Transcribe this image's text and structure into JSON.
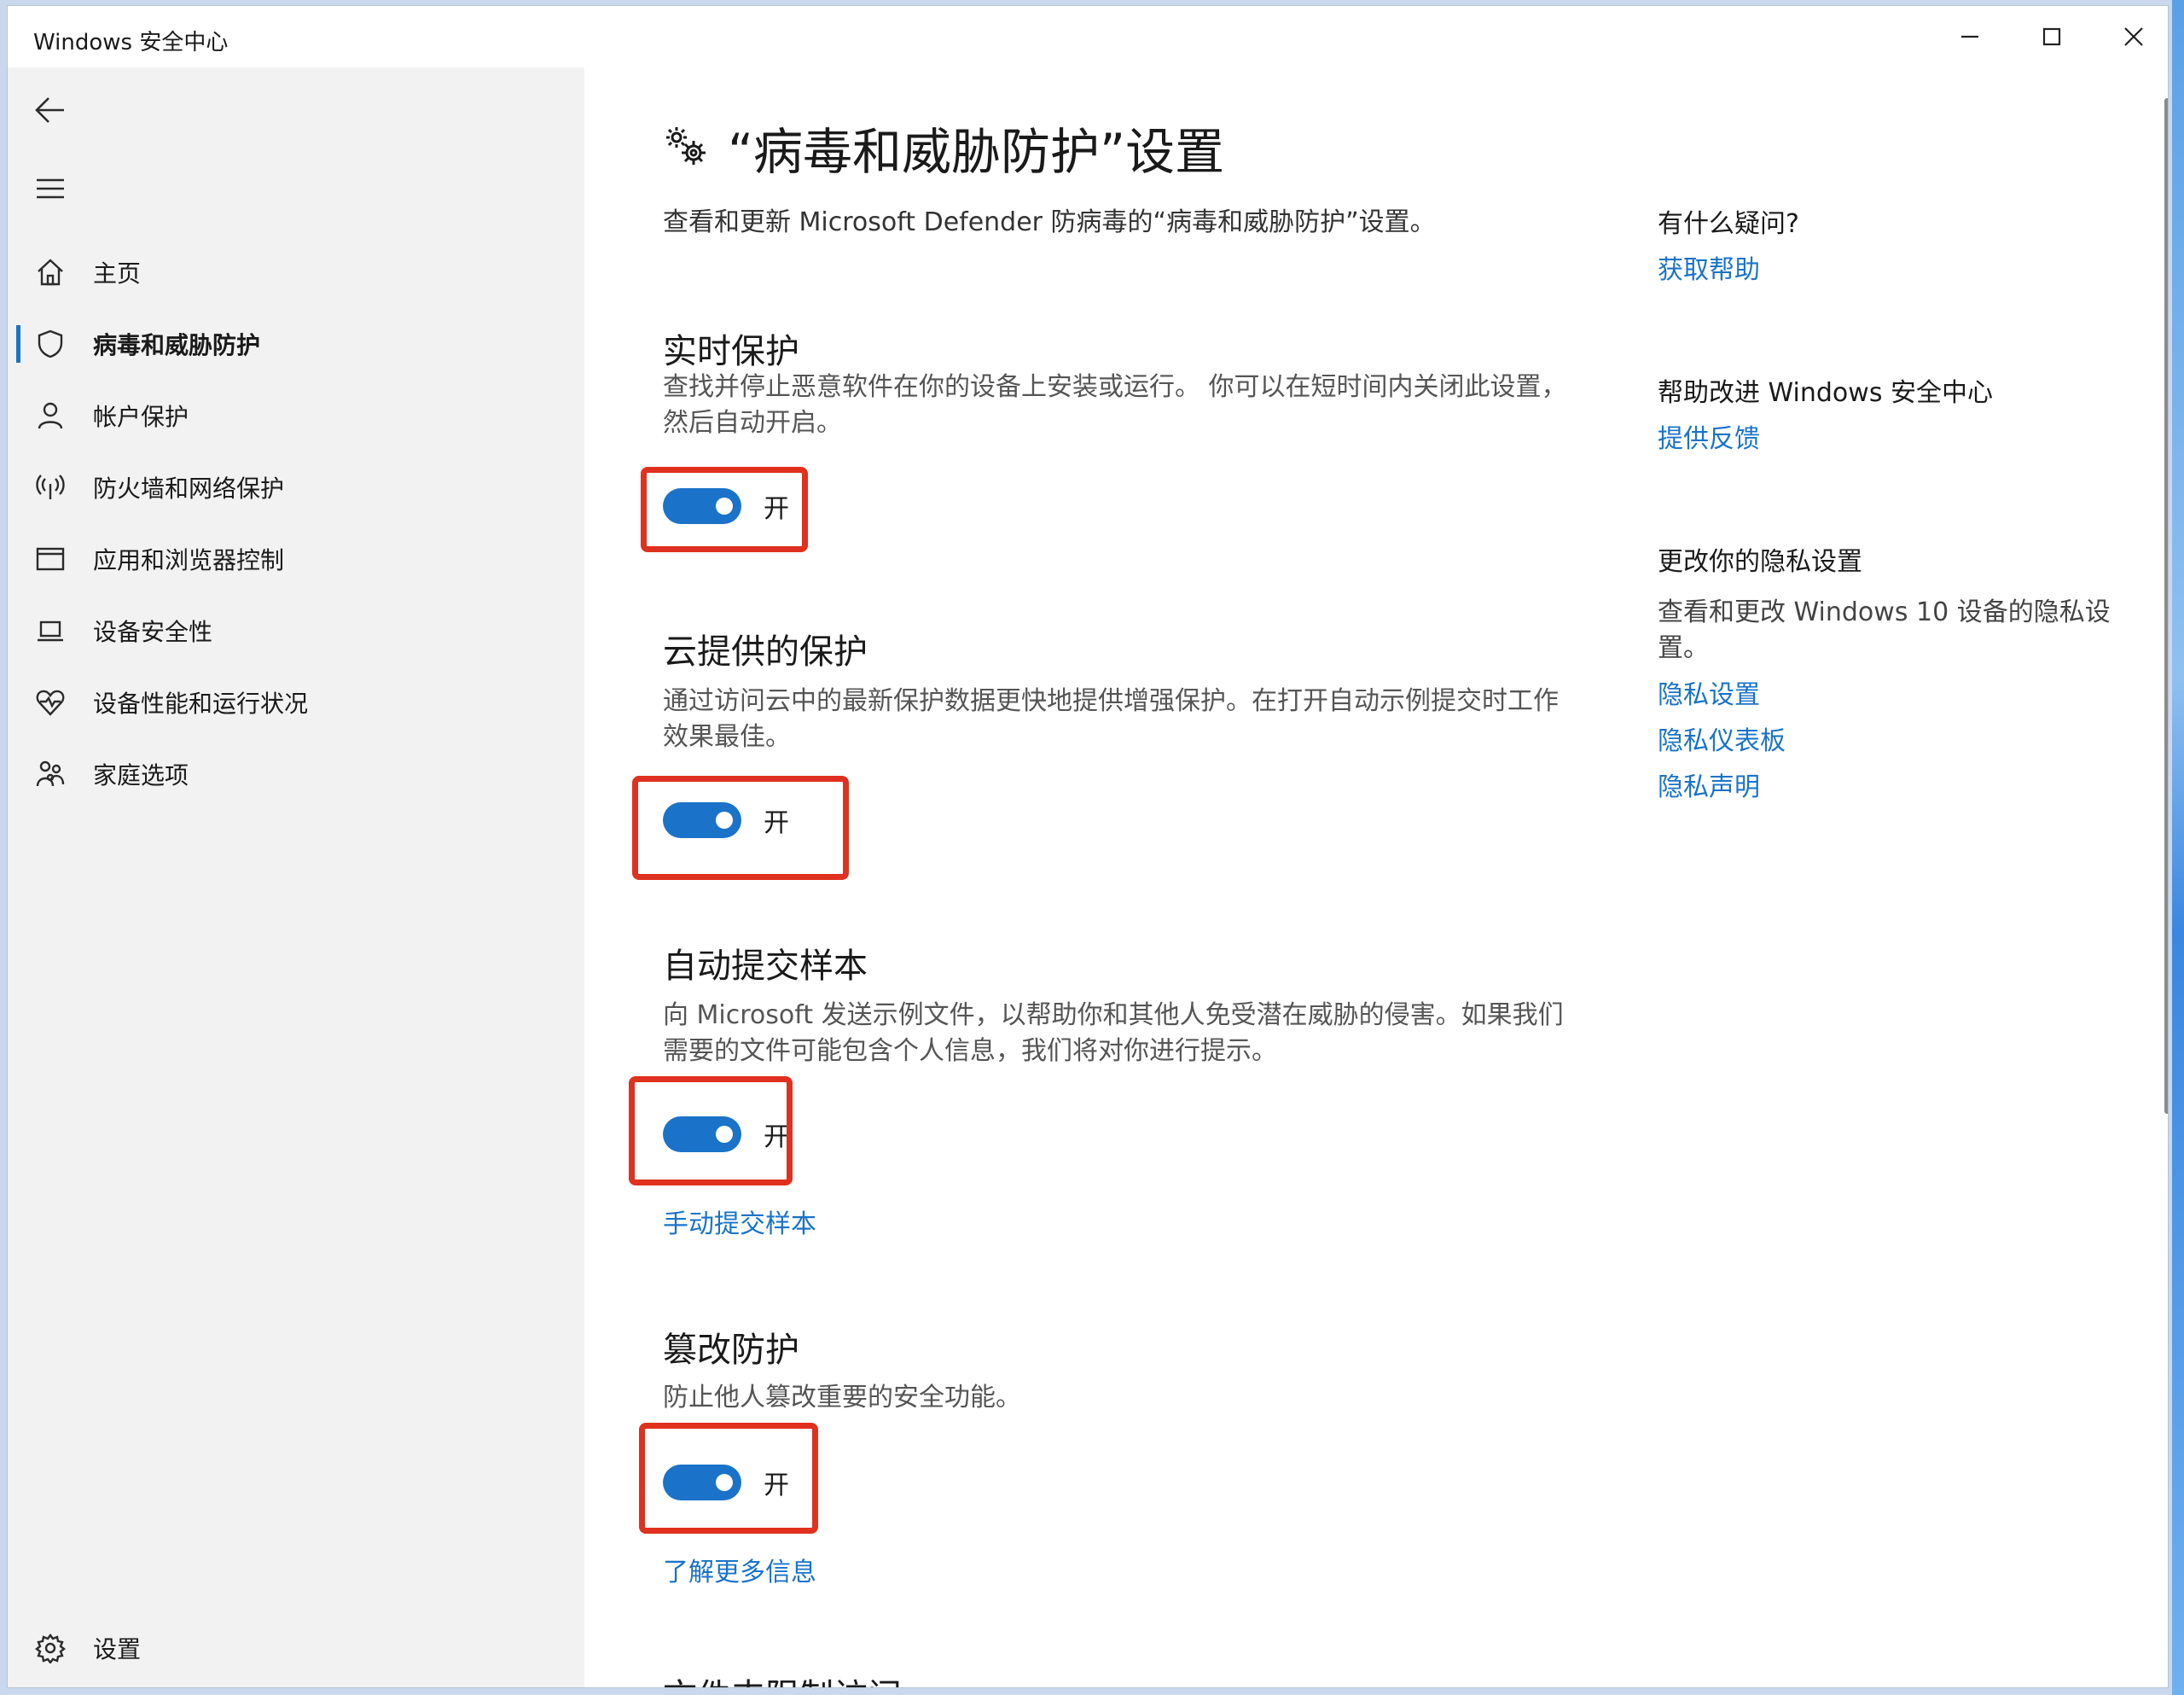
{
  "window": {
    "title": "Windows 安全中心",
    "buttons": [
      "minimize",
      "maximize",
      "close"
    ]
  },
  "sidebar": {
    "back_icon": "back-arrow-icon",
    "menu_icon": "hamburger-icon",
    "items": [
      {
        "label": "主页",
        "icon": "home-icon"
      },
      {
        "label": "病毒和威胁防护",
        "icon": "shield-icon",
        "active": true
      },
      {
        "label": "帐户保护",
        "icon": "person-icon"
      },
      {
        "label": "防火墙和网络保护",
        "icon": "wifi-antenna-icon"
      },
      {
        "label": "应用和浏览器控制",
        "icon": "browser-window-icon"
      },
      {
        "label": "设备安全性",
        "icon": "laptop-icon"
      },
      {
        "label": "设备性能和运行状况",
        "icon": "heart-pulse-icon"
      },
      {
        "label": "家庭选项",
        "icon": "family-icon"
      }
    ],
    "settings_label": "设置"
  },
  "main": {
    "title": "“病毒和威胁防护”设置",
    "subtitle": "查看和更新 Microsoft Defender 防病毒的“病毒和威胁防护”设置。",
    "sections": [
      {
        "title": "实时保护",
        "desc": "查找并停止恶意软件在你的设备上安装或运行。 你可以在短时间内关闭此设置，然后自动开启。",
        "toggle_state": "开",
        "toggle_on": true
      },
      {
        "title": "云提供的保护",
        "desc": "通过访问云中的最新保护数据更快地提供增强保护。在打开自动示例提交时工作效果最佳。",
        "toggle_state": "开",
        "toggle_on": true
      },
      {
        "title": "自动提交样本",
        "desc": "向 Microsoft 发送示例文件，以帮助你和其他人免受潜在威胁的侵害。如果我们需要的文件可能包含个人信息，我们将对你进行提示。",
        "toggle_state": "开",
        "toggle_on": true,
        "link": "手动提交样本"
      },
      {
        "title": "篡改防护",
        "desc": "防止他人篡改重要的安全功能。",
        "toggle_state": "开",
        "toggle_on": true,
        "link": "了解更多信息"
      }
    ],
    "cut_off_title": "文件夹限制访问"
  },
  "right": {
    "help_heading": "有什么疑问?",
    "help_link": "获取帮助",
    "improve_heading": "帮助改进 Windows 安全中心",
    "improve_link": "提供反馈",
    "privacy_heading": "更改你的隐私设置",
    "privacy_text": "查看和更改 Windows 10 设备的隐私设置。",
    "privacy_links": [
      "隐私设置",
      "隐私仪表板",
      "隐私声明"
    ]
  },
  "colors": {
    "accent": "#1a73c8",
    "highlight": "#e0301e",
    "sidebar_bg": "#f2f2f2"
  }
}
